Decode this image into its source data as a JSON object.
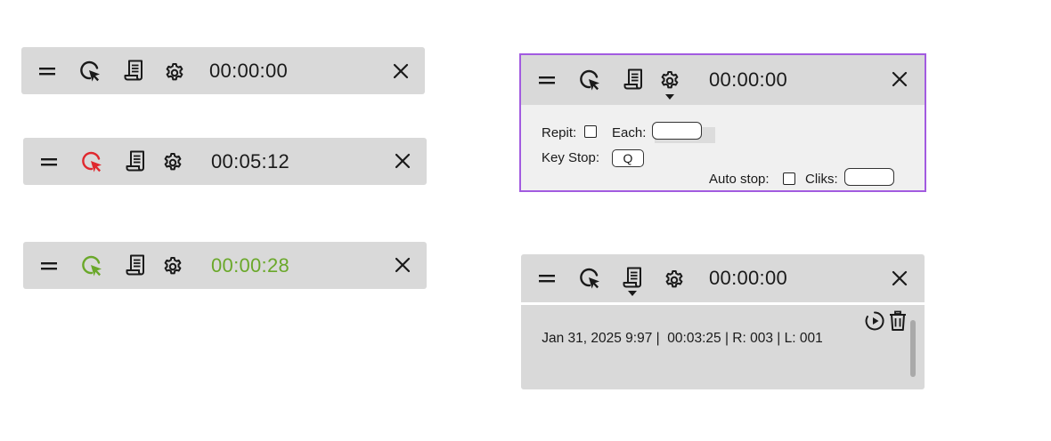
{
  "bars": [
    {
      "time": "00:00:00",
      "time_color": "#1a1a1a",
      "cursor_color": "#1a1a1a"
    },
    {
      "time": "00:05:12",
      "time_color": "#1a1a1a",
      "cursor_color": "#e0282e"
    },
    {
      "time": "00:00:28",
      "time_color": "#6aa82a",
      "cursor_color": "#6aa82a"
    }
  ],
  "settings_panel": {
    "time": "00:00:00",
    "repit_label": "Repit:",
    "each_label": "Each:",
    "key_stop_label": "Key Stop:",
    "key_stop_value": "Q",
    "auto_stop_label": "Auto stop:",
    "cliks_label": "Cliks:",
    "border_color": "#a25be0"
  },
  "log_panel": {
    "time": "00:00:00",
    "entries": [
      {
        "date": "Jan 31, 2025 9:97",
        "duration": "00:03:25",
        "repeats": "R: 003",
        "loops": "L: 001"
      }
    ]
  },
  "icons": [
    "menu-icon",
    "cursor-click-icon",
    "scroll-log-icon",
    "gear-icon",
    "close-icon",
    "play-icon",
    "trash-icon"
  ]
}
